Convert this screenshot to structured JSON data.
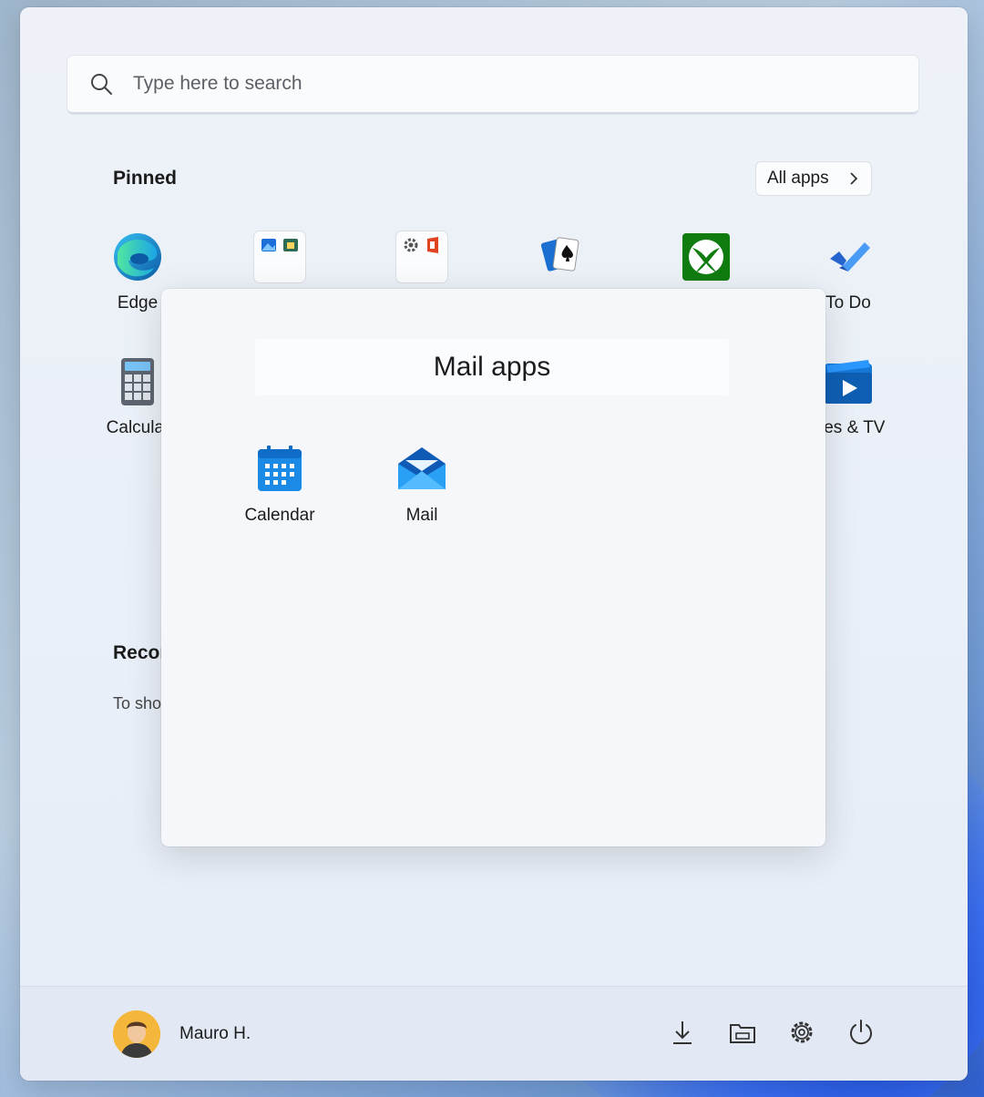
{
  "search": {
    "placeholder": "Type here to search"
  },
  "pinned": {
    "title": "Pinned",
    "all_apps_label": "All apps",
    "apps": [
      {
        "label": "Edge"
      },
      {
        "label": ""
      },
      {
        "label": ""
      },
      {
        "label": ""
      },
      {
        "label": ""
      },
      {
        "label": "To Do"
      },
      {
        "label": "Calculat"
      },
      {
        "label": "vies & TV"
      }
    ]
  },
  "folder": {
    "title": "Mail apps",
    "apps": [
      {
        "label": "Calendar"
      },
      {
        "label": "Mail"
      }
    ]
  },
  "recommended": {
    "title": "Recor",
    "subtitle": "To sho"
  },
  "footer": {
    "user_name": "Mauro H."
  },
  "colors": {
    "accent": "#0078d4",
    "xbox_green": "#107c10",
    "avatar_bg": "#f5b73b"
  }
}
